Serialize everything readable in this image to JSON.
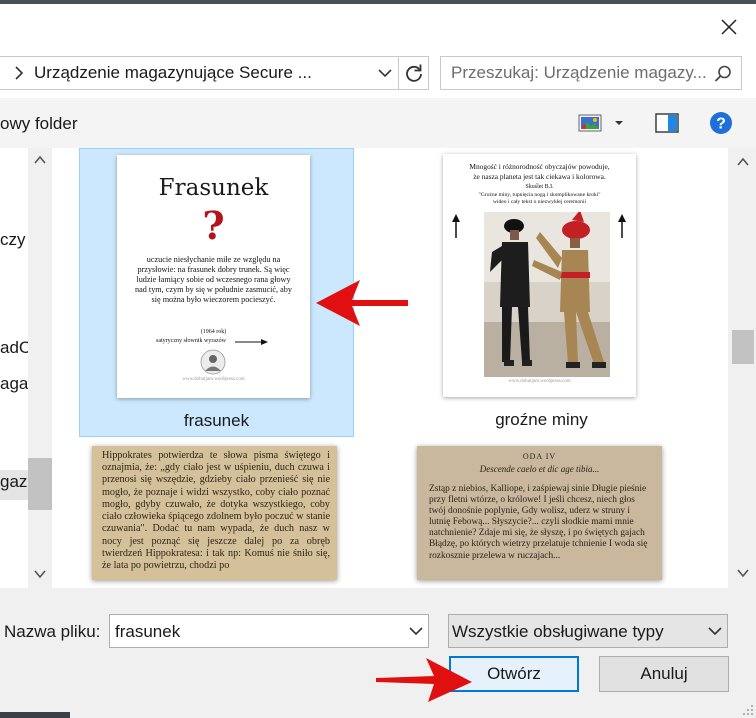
{
  "dialog": {
    "close_icon": "close-icon"
  },
  "address": {
    "path": "Urządzenie magazynujące Secure ...",
    "refresh_icon": "refresh-icon"
  },
  "search": {
    "placeholder": "Przeszukaj: Urządzenie magazy..."
  },
  "toolbar": {
    "new_folder_label": "owy folder",
    "view_icon": "image-view-icon",
    "pane_icon": "preview-pane-icon",
    "help_icon": "help-icon"
  },
  "nav": {
    "items": [
      {
        "label": "czy"
      },
      {
        "label": "adC"
      },
      {
        "label": "aga"
      },
      {
        "label": "gaz"
      }
    ]
  },
  "files": [
    {
      "name": "frasunek",
      "selected": true,
      "thumb": {
        "title": "Frasunek",
        "symbol": "?",
        "body": "uczucie niesłychanie miłe ze względu na przysłowie: na frasunek dobry trunek. Są więc ludzie łamiący sobie od wczesnego rana głowy nad tym, czym by się w południe zasmucić, aby się można było wieczorem pocieszyć.",
        "year": "(1964 rok)",
        "source": "satyryczny słownik wyrazów",
        "url": "www.dobutjam.wordpress.com"
      }
    },
    {
      "name": "groźne miny",
      "selected": false,
      "thumb": {
        "line1": "Mnogość i różnorodność obyczajów powoduje,",
        "line2": "że nasza planeta jest tak ciekawa i kolorowa.",
        "line3": "Skuślet B.I.",
        "line4": "\"Groźne miny, tupnięcia nogą i skomplikowane kroki\"",
        "line5": "wideo i cały tekst o niezwykłej ceremonii",
        "url": "www.dobutjam.wordpress.com"
      }
    },
    {
      "name": "",
      "selected": false,
      "thumb": {
        "text": "Hippokrates potwierdza te słowa pisma świętego i oznajmia, że: „gdy ciało jest w uśpieniu, duch czuwa i przenosi się wszędzie, gdzieby ciało przenieść się nie mogło, że poznaje i widzi wszystko, coby ciało poznać mogło, gdyby czuwało, że dotyka wszystkiego, coby ciało człowieka śpiącego zdolnem było poczuć w stanie czuwania\". Dodać tu nam wypada, że duch nasz w nocy jest poznąć się jeszcze dalej po za obręb twierdzeń Hippokratesa: i tak np: Komuś nie śniło się, że lata po powietrzu, chodzi po"
      }
    },
    {
      "name": "",
      "selected": false,
      "thumb": {
        "heading": "ODA IV",
        "subheading": "Descende caelo et dic age tibia...",
        "text": "Zstąp z niebios, Kalliope, i zaśpiewaj sinie Długie pieśnie przy fletni wtórze, o królowe! I jeśli chcesz, niech głos twój donośnie poplynie, Gdy wolisz, uderz w struny i lutnię Febową... Słyszycie?... czyli słodkie mami mnie natchnienie? Zdaje mi się, że słyszę, i po świętych gajach Błądzę, po których wietrzy przelatuje tchnienie I woda się rozkosznie przelewa w ruczajach..."
      }
    }
  ],
  "bottom": {
    "filename_label": "Nazwa pliku:",
    "filename_value": "frasunek",
    "filetype_value": "Wszystkie obsługiwane typy",
    "open_label": "Otwórz",
    "cancel_label": "Anuluj"
  },
  "colors": {
    "selection": "#cce8ff",
    "accent": "#0078d7",
    "annotation_arrow": "#e01010"
  }
}
